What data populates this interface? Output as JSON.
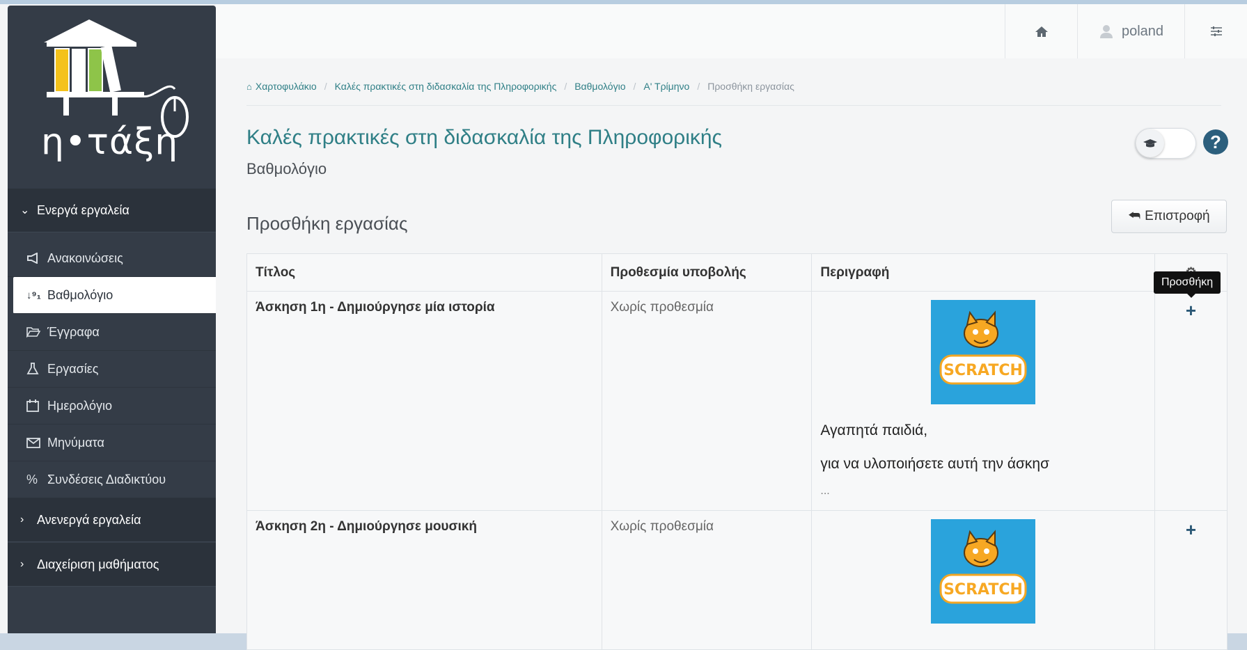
{
  "sidebar": {
    "logo_text": "η•τάξη",
    "active_tools_label": "Ενεργά εργαλεία",
    "items": [
      {
        "label": "Ανακοινώσεις",
        "icon": "bullhorn-icon"
      },
      {
        "label": "Βαθμολόγιο",
        "icon": "sort-numeric-icon"
      },
      {
        "label": "Έγγραφα",
        "icon": "folder-open-icon"
      },
      {
        "label": "Εργασίες",
        "icon": "flask-icon"
      },
      {
        "label": "Ημερολόγιο",
        "icon": "calendar-icon"
      },
      {
        "label": "Μηνύματα",
        "icon": "envelope-icon"
      },
      {
        "label": "Συνδέσεις Διαδικτύου",
        "icon": "link-icon"
      }
    ],
    "inactive_tools_label": "Ανενεργά εργαλεία",
    "course_admin_label": "Διαχείριση μαθήματος"
  },
  "topbar": {
    "user": "poland"
  },
  "breadcrumb": [
    "Χαρτοφυλάκιο",
    "Καλές πρακτικές στη διδασκαλία της Πληροφορικής",
    "Βαθμολόγιο",
    "Α' Τρίμηνο",
    "Προσθήκη εργασίας"
  ],
  "page": {
    "course_title": "Καλές πρακτικές στη διδασκαλία της Πληροφορικής",
    "subtitle": "Βαθμολόγιο",
    "section_title": "Προσθήκη εργασίας",
    "back_label": "Επιστροφή",
    "tooltip": "Προσθήκη"
  },
  "table": {
    "headers": [
      "Τίτλος",
      "Προθεσμία υποβολής",
      "Περιγραφή"
    ],
    "rows": [
      {
        "title": "Άσκηση 1η - Δημιούργησε μία ιστορία",
        "deadline": "Χωρίς προθεσμία",
        "image_label": "SCRATCH",
        "desc_line1": "Αγαπητά παιδιά,",
        "desc_line2": "για να υλοποιήσετε αυτή την άσκησ",
        "desc_more": "..."
      },
      {
        "title": "Άσκηση 2η - Δημιούργησε μουσική",
        "deadline": "Χωρίς προθεσμία",
        "image_label": "SCRATCH"
      }
    ]
  },
  "colors": {
    "sidebar": "#343c47",
    "accent": "#2f7f86",
    "scratch_bg": "#2aa3dc"
  }
}
